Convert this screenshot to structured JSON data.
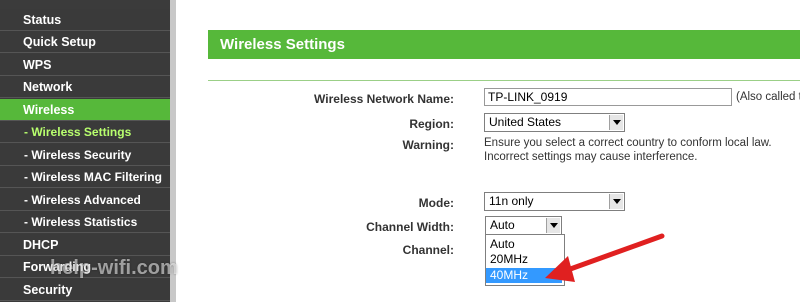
{
  "sidebar": {
    "items": [
      {
        "label": "Status"
      },
      {
        "label": "Quick Setup"
      },
      {
        "label": "WPS"
      },
      {
        "label": "Network"
      },
      {
        "label": "Wireless"
      },
      {
        "label": "- Wireless Settings"
      },
      {
        "label": "- Wireless Security"
      },
      {
        "label": "- Wireless MAC Filtering"
      },
      {
        "label": "- Wireless Advanced"
      },
      {
        "label": "- Wireless Statistics"
      },
      {
        "label": "DHCP"
      },
      {
        "label": "Forwarding"
      },
      {
        "label": "Security"
      }
    ]
  },
  "content": {
    "title": "Wireless Settings",
    "network_name_label": "Wireless Network Name:",
    "network_name_value": "TP-LINK_0919",
    "also_text": "(Also called t",
    "region_label": "Region:",
    "region_value": "United States",
    "warning_label": "Warning:",
    "warning_line1": "Ensure you select a correct country to conform local law.",
    "warning_line2": "Incorrect settings may cause interference.",
    "mode_label": "Mode:",
    "mode_value": "11n only",
    "channel_width_label": "Channel Width:",
    "channel_width_value": "Auto",
    "channel_label": "Channel:",
    "channel_width_options": [
      "Auto",
      "20MHz",
      "40MHz"
    ],
    "selected_option": "40MHz"
  },
  "watermark": "help-wifi.com",
  "colors": {
    "accent_green": "#56b83a",
    "sidebar_bg": "#3a3a3a",
    "highlight_blue": "#3399ff",
    "arrow_red": "#e02020"
  }
}
